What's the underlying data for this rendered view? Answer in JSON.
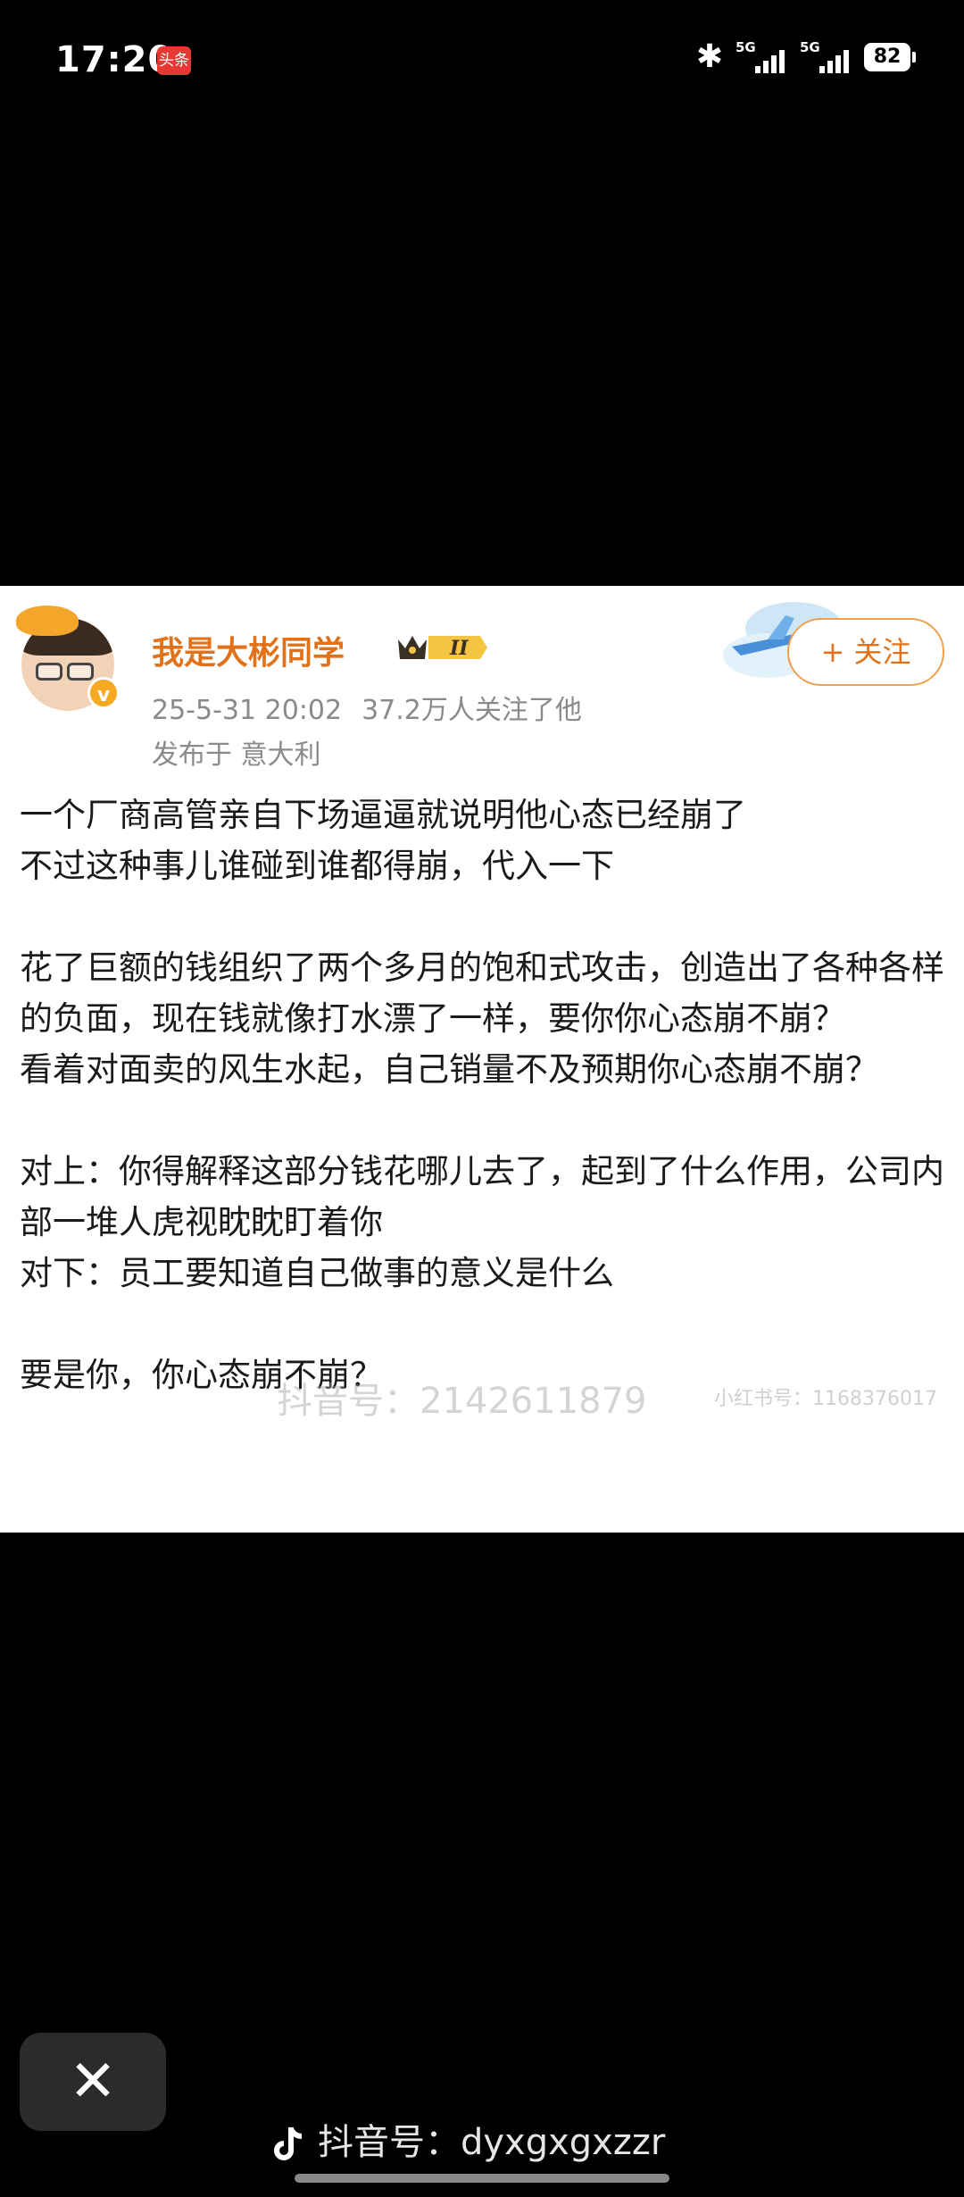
{
  "status_bar": {
    "time": "17:20",
    "app_badge": "头条",
    "network1": "5G",
    "network2": "5G",
    "battery": "82"
  },
  "post": {
    "username": "我是大彬同学",
    "level_badge": "II",
    "date": "25-5-31 20:02",
    "followers": "37.2万人关注了他",
    "location": "发布于 意大利",
    "follow_button": "+ 关注",
    "paragraphs": [
      "一个厂商高管亲自下场逼逼就说明他心态已经崩了",
      "不过这种事儿谁碰到谁都得崩，代入一下",
      "",
      "花了巨额的钱组织了两个多月的饱和式攻击，创造出了各种各样的负面，现在钱就像打水漂了一样，要你你心态崩不崩？",
      "看着对面卖的风生水起，自己销量不及预期你心态崩不崩？",
      "",
      "对上：你得解释这部分钱花哪儿去了，起到了什么作用，公司内部一堆人虎视眈眈盯着你",
      "对下：员工要知道自己做事的意义是什么",
      "",
      "要是你，你心态崩不崩？"
    ],
    "watermark": "抖音号：2142611879",
    "watermark_small": "小红书号：1168376017"
  },
  "bottom": {
    "close_symbol": "✕",
    "douyin_watermark": "抖音号：dyxgxgxzzr"
  },
  "colors": {
    "username": "#e1721a",
    "follow_border": "#f0a04b",
    "meta_text": "#8a8a8a"
  },
  "icons": [
    "bluetooth-icon",
    "signal-icon",
    "battery-icon",
    "verified-badge-icon",
    "crown-icon",
    "close-icon",
    "douyin-logo-icon"
  ]
}
